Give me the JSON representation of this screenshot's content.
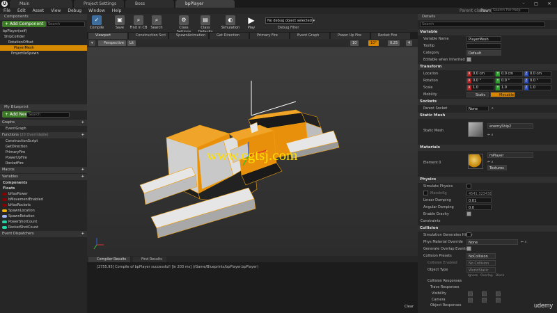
{
  "title_tabs": [
    {
      "label": "Main",
      "active": false
    },
    {
      "label": "Project Settings",
      "active": false
    },
    {
      "label": "Boss",
      "active": false
    },
    {
      "label": "bpPlayer",
      "active": true
    }
  ],
  "parent_class": {
    "label": "Parent class:",
    "value": "Pawn"
  },
  "help_search_placeholder": "Search For Help",
  "menu": [
    "File",
    "Edit",
    "Asset",
    "View",
    "Debug",
    "Window",
    "Help"
  ],
  "components_panel": {
    "title": "Components",
    "add_button": "+ Add Component",
    "search_placeholder": "Search",
    "self_item": "bpPlayer(self)",
    "tree": [
      {
        "label": "ShipCollider",
        "level": 0,
        "selected": false
      },
      {
        "label": "RotationOffset",
        "level": 1,
        "selected": false
      },
      {
        "label": "PlayerMesh",
        "level": 2,
        "selected": true
      },
      {
        "label": "ProjectileSpawn",
        "level": 1,
        "selected": false
      }
    ]
  },
  "blueprint_panel": {
    "title": "My Blueprint",
    "add_button": "+ Add New",
    "search_placeholder": "Search",
    "graphs_label": "Graphs",
    "graphs": [
      "EventGraph"
    ],
    "functions_label": "Functions",
    "functions_note": "(20 Overridable)",
    "functions": [
      "ConstructionScript",
      "GetDirection",
      "PrimaryFire",
      "PowerUpFire",
      "RocketFire"
    ],
    "macros_label": "Macros",
    "variables_label": "Variables",
    "var_groups": [
      "Components",
      "Floats"
    ],
    "variables": [
      {
        "name": "bHasPower",
        "color": "#8a0000"
      },
      {
        "name": "bMovementEnabled",
        "color": "#8a0000"
      },
      {
        "name": "bHasRockets",
        "color": "#8a0000"
      },
      {
        "name": "SpawnLocation",
        "color": "#f0b000"
      },
      {
        "name": "SpawnRotation",
        "color": "#a0b4ff"
      },
      {
        "name": "PowerShotCount",
        "color": "#1ed6a6"
      },
      {
        "name": "RocketShotCount",
        "color": "#1ed6a6"
      }
    ],
    "dispatchers_label": "Event Dispatchers"
  },
  "toolbar": {
    "buttons": [
      {
        "label": "Compile",
        "icon": "compile-icon"
      },
      {
        "label": "Save",
        "icon": "save-icon"
      },
      {
        "label": "Find in CB",
        "icon": "find-icon"
      },
      {
        "label": "Search",
        "icon": "search-icon"
      },
      {
        "label": "Class Settings",
        "icon": "gear-icon"
      },
      {
        "label": "Class Defaults",
        "icon": "defaults-icon"
      },
      {
        "label": "Simulation",
        "icon": "simulation-icon"
      },
      {
        "label": "Play",
        "icon": "play-icon"
      }
    ],
    "debug_object": "No debug object selected",
    "debug_filter": "Debug Filter"
  },
  "editor_tabs": [
    {
      "label": "Viewport",
      "active": true
    },
    {
      "label": "Construction Scri",
      "active": false
    },
    {
      "label": "SpawnAnimation",
      "active": false
    },
    {
      "label": "Get Direction",
      "active": false
    },
    {
      "label": "Primary Fire",
      "active": false
    },
    {
      "label": "Event Graph",
      "active": false
    },
    {
      "label": "Power Up Fire",
      "active": false
    },
    {
      "label": "Rocket Fire",
      "active": false
    }
  ],
  "viewport": {
    "perspective": "Perspective",
    "lit": "Lit",
    "grid_snap": "10",
    "rot_snap": "10°",
    "scale_snap": "0.25",
    "cam_speed": "4",
    "watermark": "www.cgtsj.com"
  },
  "compiler": {
    "tabs": [
      {
        "label": "Compiler Results",
        "active": true
      },
      {
        "label": "Find Results",
        "active": false
      }
    ],
    "message": "[2755.95] Compile of bpPlayer successful! [in 203 ms] (/Game/Blueprints/bpPlayer.bpPlayer)",
    "clear": "Clear"
  },
  "details": {
    "title": "Details",
    "search_placeholder": "Search",
    "variable": {
      "header": "Variable",
      "name_label": "Variable Name",
      "name": "PlayerMesh",
      "tooltip_label": "Tooltip",
      "tooltip": "",
      "category_label": "Category",
      "category": "Default",
      "editable_label": "Editable when Inherited"
    },
    "transform": {
      "header": "Transform",
      "location_label": "Location",
      "location": [
        "0.0 cm",
        "0.0 cm",
        "0.0 cm"
      ],
      "rotation_label": "Rotation",
      "rotation": [
        "0.0 °",
        "0.0 °",
        "0.0 °"
      ],
      "scale_label": "Scale",
      "scale": [
        "1.0",
        "1.0",
        "1.0"
      ],
      "mobility_label": "Mobility",
      "mobility": [
        "Static",
        "Movable"
      ]
    },
    "sockets": {
      "header": "Sockets",
      "parent_label": "Parent Socket",
      "parent": "None"
    },
    "static_mesh": {
      "header": "Static Mesh",
      "label": "Static Mesh",
      "value": "enemyShip2"
    },
    "materials": {
      "header": "Materials",
      "label": "Element 0",
      "value": "mPlayer",
      "textures": "Textures"
    },
    "physics": {
      "header": "Physics",
      "simulate": "Simulate Physics",
      "mass_label": "MassInKg",
      "mass": "4541.323438",
      "linear_label": "Linear Damping",
      "linear": "0.01",
      "angular_label": "Angular Damping",
      "angular": "0.0",
      "gravity": "Enable Gravity",
      "constraints": "Constraints"
    },
    "collision": {
      "header": "Collision",
      "sim_hit": "Simulation Generates Hit Ev",
      "phys_label": "Phys Material Override",
      "phys": "None",
      "overlap": "Generate Overlap Events",
      "presets_label": "Collision Presets",
      "presets": "NoCollision",
      "enabled_label": "Collision Enabled",
      "enabled": "No Collision",
      "objtype_label": "Object Type",
      "objtype": "WorldStatic",
      "cols": [
        "Ignore",
        "Overlap",
        "Block"
      ],
      "responses": "Collision Responses",
      "trace": "Trace Responses",
      "visibility": "Visibility",
      "camera": "Camera",
      "object": "Object Responses"
    }
  },
  "udemy": "udemy"
}
